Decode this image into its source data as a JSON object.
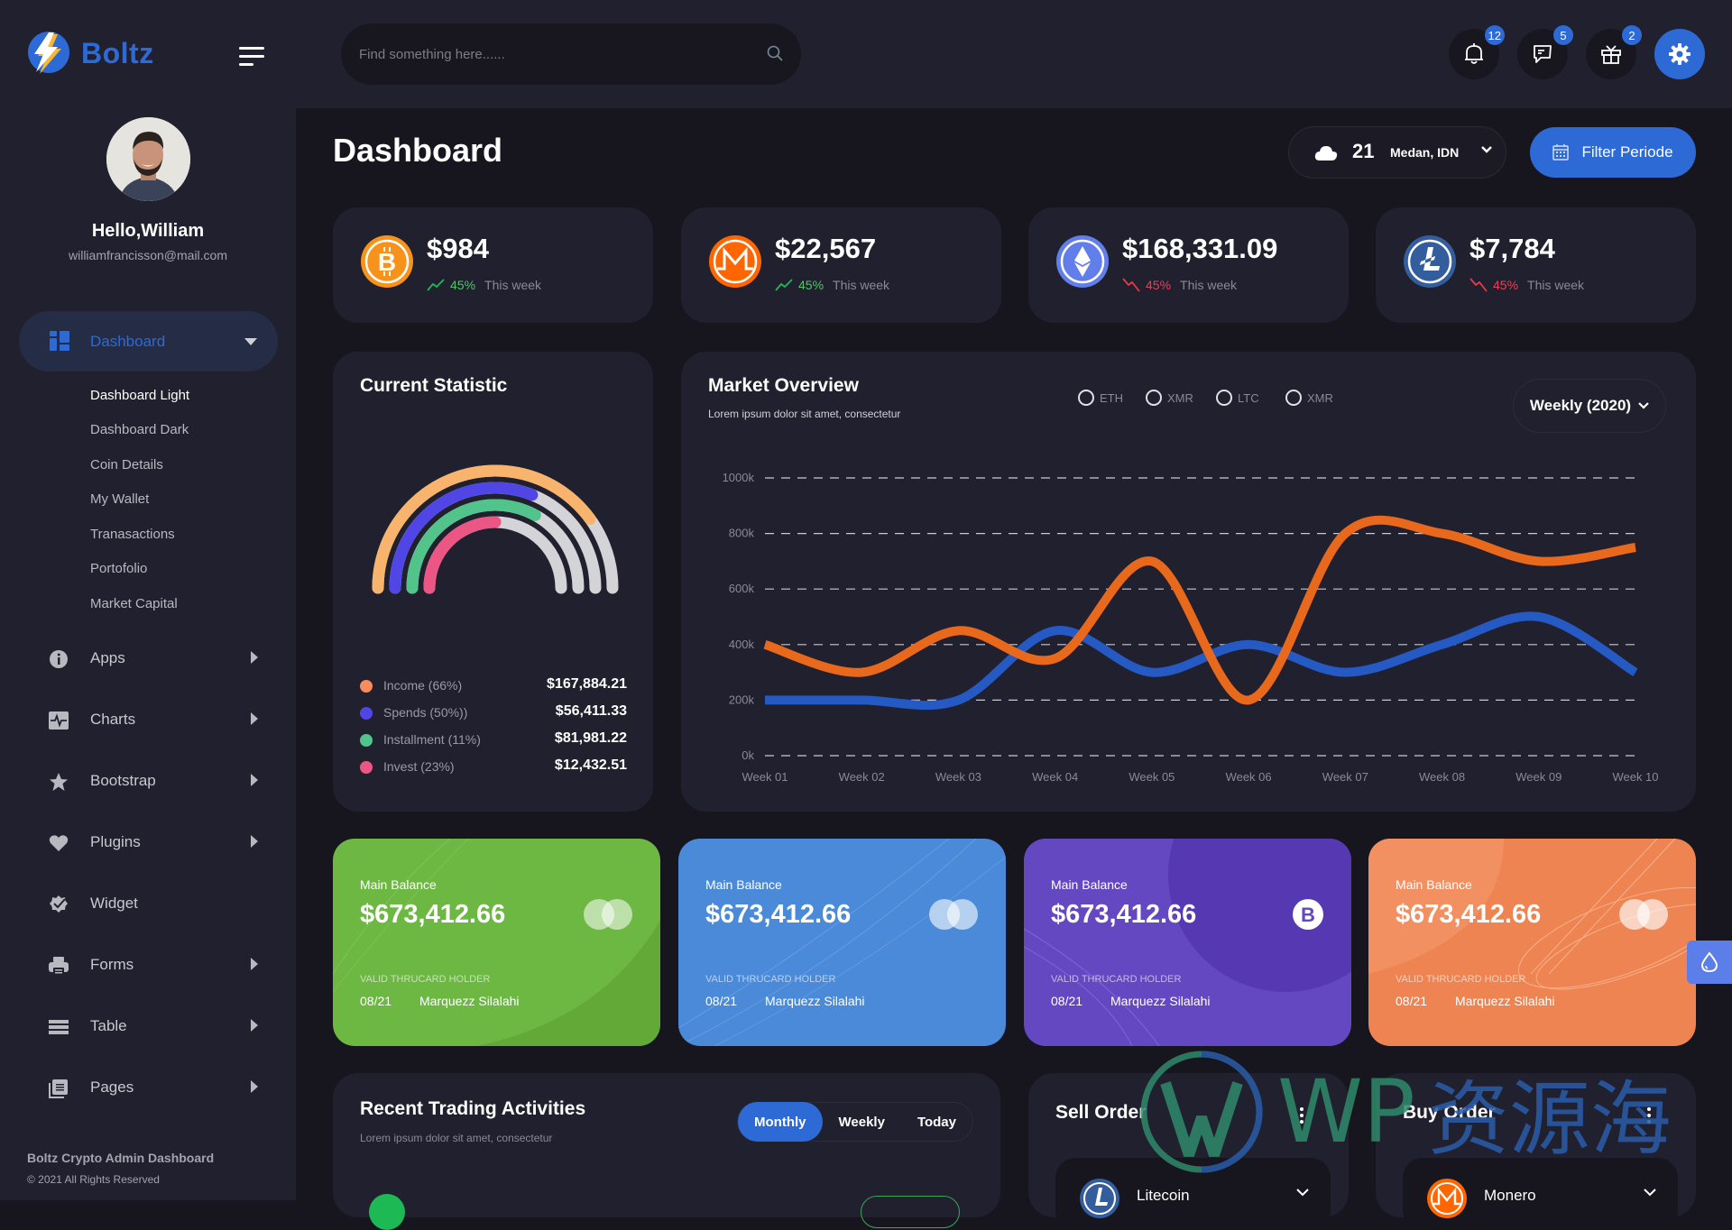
{
  "brand": {
    "name": "Boltz",
    "accent": "#2d6ad6"
  },
  "user": {
    "greeting": "Hello,William",
    "email": "williamfrancisson@mail.com"
  },
  "sidebar": {
    "active": {
      "label": "Dashboard"
    },
    "submenu": [
      "Dashboard Light",
      "Dashboard Dark",
      "Coin Details",
      "My Wallet",
      "Tranasactions",
      "Portofolio",
      "Market Capital"
    ],
    "items": [
      {
        "label": "Apps",
        "icon": "info-icon",
        "arrow": true
      },
      {
        "label": "Charts",
        "icon": "pulse-chart-icon",
        "arrow": true
      },
      {
        "label": "Bootstrap",
        "icon": "star-icon",
        "arrow": true
      },
      {
        "label": "Plugins",
        "icon": "heart-icon",
        "arrow": true
      },
      {
        "label": "Widget",
        "icon": "badge-check-icon",
        "arrow": false
      },
      {
        "label": "Forms",
        "icon": "printer-icon",
        "arrow": true
      },
      {
        "label": "Table",
        "icon": "list-icon",
        "arrow": true
      },
      {
        "label": "Pages",
        "icon": "copy-icon",
        "arrow": true
      }
    ],
    "footer_title": "Boltz Crypto Admin Dashboard",
    "footer_copy": "© 2021 All Rights Reserved"
  },
  "header": {
    "search_placeholder": "Find something here......",
    "notifications": {
      "icon": "bell-icon",
      "count": "12"
    },
    "messages": {
      "icon": "chat-icon",
      "count": "5"
    },
    "gifts": {
      "icon": "gift-icon",
      "count": "2"
    }
  },
  "page": {
    "title": "Dashboard",
    "weather": {
      "temp": "21",
      "location": "Medan, IDN"
    },
    "filter_label": "Filter Periode"
  },
  "coins": [
    {
      "name": "Bitcoin",
      "amount": "$984",
      "change": "45%",
      "trend": "up",
      "label": "This week",
      "color": "#f7931a"
    },
    {
      "name": "Monero",
      "amount": "$22,567",
      "change": "45%",
      "trend": "up",
      "label": "This week",
      "color": "#ff6600"
    },
    {
      "name": "Ethereum",
      "amount": "$168,331.09",
      "change": "45%",
      "trend": "down",
      "label": "This week",
      "color": "#627eea"
    },
    {
      "name": "Litecoin",
      "amount": "$7,784",
      "change": "45%",
      "trend": "down",
      "label": "This week",
      "color": "#345d9d"
    }
  ],
  "current_statistic": {
    "title": "Current Statistic",
    "rows": [
      {
        "name": "Income (66%)",
        "value": "$167,884.21",
        "color": "#f98b5c",
        "fill": 0.8
      },
      {
        "name": "Spends (50%))",
        "value": "$56,411.33",
        "color": "#5046e5",
        "fill": 0.62
      },
      {
        "name": "Installment (11%)",
        "value": "$81,981.22",
        "color": "#52c48b",
        "fill": 0.66
      },
      {
        "name": "Invest (23%)",
        "value": "$12,432.51",
        "color": "#ec5685",
        "fill": 0.5
      }
    ]
  },
  "market_overview": {
    "title": "Market Overview",
    "subtitle": "Lorem ipsum dolor sit amet, consectetur",
    "filters": [
      "ETH",
      "XMR",
      "LTC",
      "XMR"
    ],
    "period": "Weekly (2020)"
  },
  "chart_data": {
    "type": "line",
    "title": "Market Overview",
    "x": [
      "Week 01",
      "Week 02",
      "Week 03",
      "Week 04",
      "Week 05",
      "Week 06",
      "Week 07",
      "Week 08",
      "Week 09",
      "Week 10"
    ],
    "yticks": [
      "0k",
      "200k",
      "400k",
      "600k",
      "800k",
      "1000k"
    ],
    "ylim": [
      0,
      1000
    ],
    "grid": true,
    "series": [
      {
        "name": "orange",
        "color": "#e8691c",
        "values": [
          400,
          300,
          450,
          350,
          700,
          200,
          800,
          800,
          700,
          750
        ]
      },
      {
        "name": "blue",
        "color": "#2559c4",
        "values": [
          200,
          200,
          200,
          450,
          300,
          400,
          300,
          400,
          500,
          300
        ]
      }
    ]
  },
  "balance_cards": [
    {
      "label": "Main Balance",
      "amount": "$673,412.66",
      "holder_label": "VALID THRUCARD HOLDER",
      "expiry": "08/21",
      "holder": "Marquezz Silalahi",
      "color": "#6db843",
      "logo": "mastercard"
    },
    {
      "label": "Main Balance",
      "amount": "$673,412.66",
      "holder_label": "VALID THRUCARD HOLDER",
      "expiry": "08/21",
      "holder": "Marquezz Silalahi",
      "color": "#4a8ad9",
      "logo": "mastercard"
    },
    {
      "label": "Main Balance",
      "amount": "$673,412.66",
      "holder_label": "VALID THRUCARD HOLDER",
      "expiry": "08/21",
      "holder": "Marquezz Silalahi",
      "color": "#6448c1",
      "logo": "bitcoin"
    },
    {
      "label": "Main Balance",
      "amount": "$673,412.66",
      "holder_label": "VALID THRUCARD HOLDER",
      "expiry": "08/21",
      "holder": "Marquezz Silalahi",
      "color": "#ee8452",
      "logo": "mastercard"
    }
  ],
  "recent_trading": {
    "title": "Recent Trading Activities",
    "subtitle": "Lorem ipsum dolor sit amet, consectetur",
    "tabs": [
      "Monthly",
      "Weekly",
      "Today"
    ],
    "active_tab": "Monthly"
  },
  "sell_order": {
    "title": "Sell Order",
    "coin": "Litecoin"
  },
  "buy_order": {
    "title": "Buy Order",
    "coin": "Monero"
  },
  "watermark": {
    "latin": "WP",
    "cjk": "资源海"
  }
}
